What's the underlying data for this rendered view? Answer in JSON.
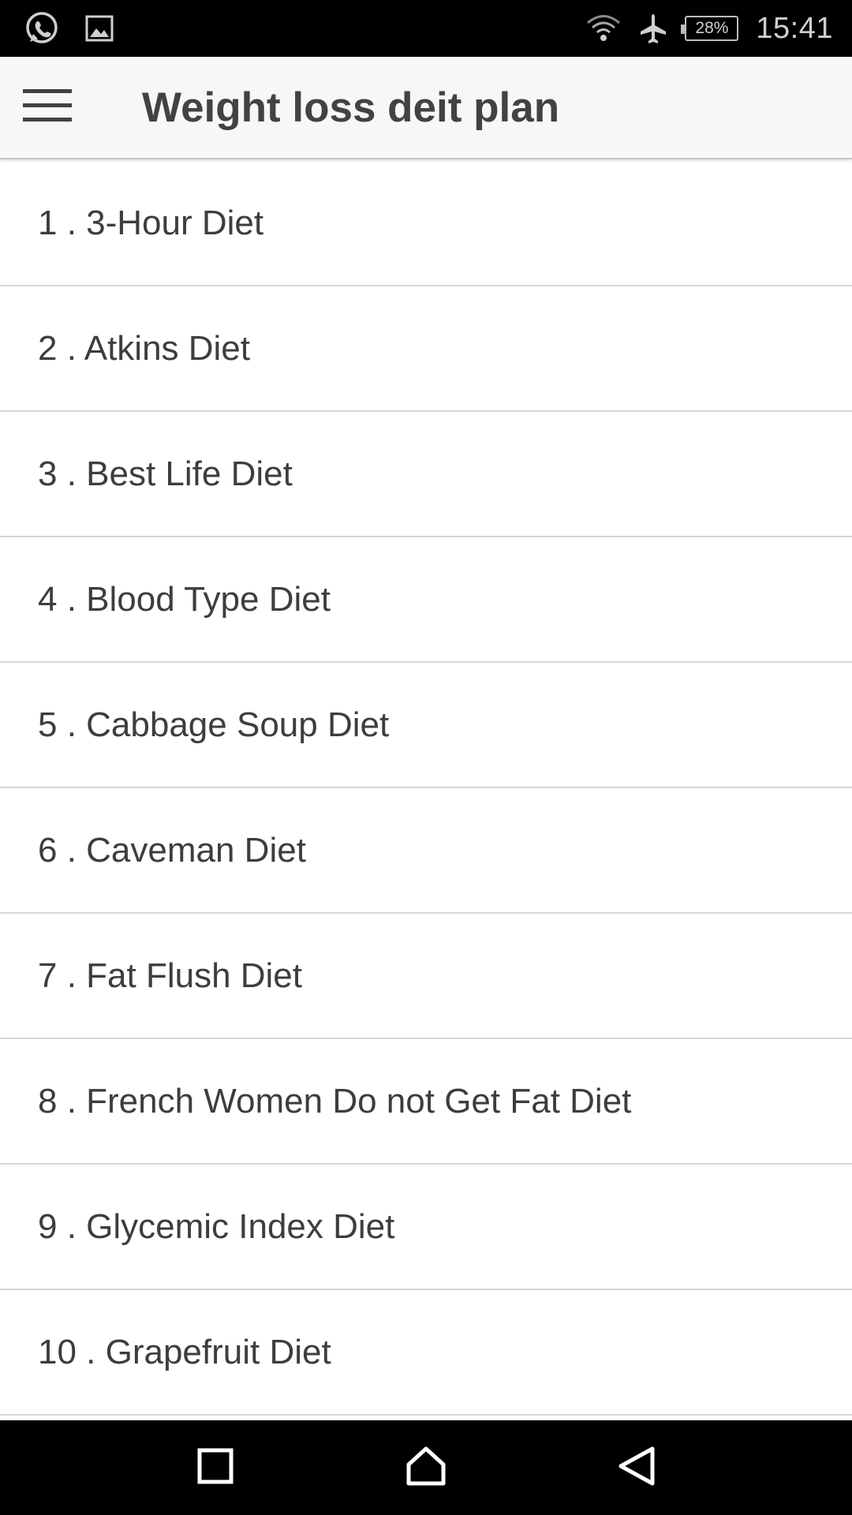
{
  "status_bar": {
    "battery_percent": "28%",
    "time": "15:41",
    "icons": [
      "whatsapp-icon",
      "gallery-icon",
      "wifi-icon",
      "airplane-icon",
      "battery-icon"
    ]
  },
  "app_bar": {
    "title": "Weight loss deit plan",
    "menu_icon": "hamburger-menu-icon"
  },
  "diet_list": [
    {
      "label": "1 . 3-Hour Diet"
    },
    {
      "label": "2 . Atkins Diet"
    },
    {
      "label": "3 . Best Life Diet"
    },
    {
      "label": "4 . Blood Type Diet"
    },
    {
      "label": "5 . Cabbage Soup Diet"
    },
    {
      "label": "6 . Caveman Diet"
    },
    {
      "label": "7 . Fat Flush Diet"
    },
    {
      "label": "8 . French Women Do not Get Fat Diet"
    },
    {
      "label": "9 . Glycemic Index Diet"
    },
    {
      "label": "10 . Grapefruit Diet"
    }
  ],
  "nav_bar": {
    "icons": [
      "recents-square-icon",
      "home-icon",
      "back-triangle-icon"
    ]
  },
  "colors": {
    "status_bar_bg": "#000000",
    "app_bar_bg": "#f7f7f7",
    "text": "#3d3d3d",
    "divider": "#d6d6d6"
  }
}
